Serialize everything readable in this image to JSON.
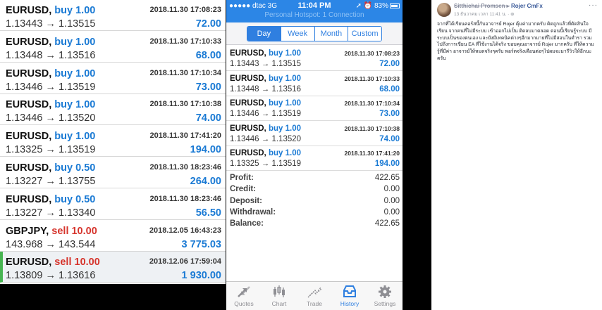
{
  "left_history": {
    "rows": [
      {
        "symbol": "EURUSD,",
        "side": "buy 1.00",
        "side_type": "buy",
        "date": "2018.11.30 17:08:23",
        "prices": "1.13443 → 1.13515",
        "profit": "72.00"
      },
      {
        "symbol": "EURUSD,",
        "side": "buy 1.00",
        "side_type": "buy",
        "date": "2018.11.30 17:10:33",
        "prices": "1.13448 → 1.13516",
        "profit": "68.00"
      },
      {
        "symbol": "EURUSD,",
        "side": "buy 1.00",
        "side_type": "buy",
        "date": "2018.11.30 17:10:34",
        "prices": "1.13446 → 1.13519",
        "profit": "73.00"
      },
      {
        "symbol": "EURUSD,",
        "side": "buy 1.00",
        "side_type": "buy",
        "date": "2018.11.30 17:10:38",
        "prices": "1.13446 → 1.13520",
        "profit": "74.00"
      },
      {
        "symbol": "EURUSD,",
        "side": "buy 1.00",
        "side_type": "buy",
        "date": "2018.11.30 17:41:20",
        "prices": "1.13325 → 1.13519",
        "profit": "194.00"
      },
      {
        "symbol": "EURUSD,",
        "side": "buy 0.50",
        "side_type": "buy",
        "date": "2018.11.30 18:23:46",
        "prices": "1.13227 → 1.13755",
        "profit": "264.00"
      },
      {
        "symbol": "EURUSD,",
        "side": "buy 0.50",
        "side_type": "buy",
        "date": "2018.11.30 18:23:46",
        "prices": "1.13227 → 1.13340",
        "profit": "56.50"
      },
      {
        "symbol": "GBPJPY,",
        "side": "sell 10.00",
        "side_type": "sell",
        "date": "2018.12.05 16:43:23",
        "prices": "143.968 → 143.544",
        "profit": "3 775.03"
      },
      {
        "symbol": "EURUSD,",
        "side": "sell 10.00",
        "side_type": "sell",
        "date": "2018.12.06 17:59:04",
        "prices": "1.13809 → 1.13616",
        "profit": "1 930.00"
      }
    ]
  },
  "phone": {
    "status": {
      "carrier": "●●●●● dtac  3G",
      "time": "11:04 PM",
      "right": "➚ ⏰ 83%",
      "hotspot": "Personal Hotspot: 1 Connection"
    },
    "segments": [
      "Day",
      "Week",
      "Month",
      "Custom"
    ],
    "active_segment": "Day",
    "rows": [
      {
        "symbol": "EURUSD,",
        "side": "buy 1.00",
        "date": "2018.11.30 17:08:23",
        "prices": "1.13443 → 1.13515",
        "profit": "72.00"
      },
      {
        "symbol": "EURUSD,",
        "side": "buy 1.00",
        "date": "2018.11.30 17:10:33",
        "prices": "1.13448 → 1.13516",
        "profit": "68.00"
      },
      {
        "symbol": "EURUSD,",
        "side": "buy 1.00",
        "date": "2018.11.30 17:10:34",
        "prices": "1.13446 → 1.13519",
        "profit": "73.00"
      },
      {
        "symbol": "EURUSD,",
        "side": "buy 1.00",
        "date": "2018.11.30 17:10:38",
        "prices": "1.13446 → 1.13520",
        "profit": "74.00"
      },
      {
        "symbol": "EURUSD,",
        "side": "buy 1.00",
        "date": "2018.11.30 17:41:20",
        "prices": "1.13325 → 1.13519",
        "profit": "194.00"
      }
    ],
    "summary": [
      {
        "label": "Profit:",
        "value": "422.65"
      },
      {
        "label": "Credit:",
        "value": "0.00"
      },
      {
        "label": "Deposit:",
        "value": "0.00"
      },
      {
        "label": "Withdrawal:",
        "value": "0.00"
      },
      {
        "label": "Balance:",
        "value": "422.65"
      }
    ],
    "tabs": [
      {
        "label": "Quotes",
        "icon": "quotes-icon"
      },
      {
        "label": "Chart",
        "icon": "chart-icon"
      },
      {
        "label": "Trade",
        "icon": "trade-icon"
      },
      {
        "label": "History",
        "icon": "history-icon"
      },
      {
        "label": "Settings",
        "icon": "settings-icon"
      }
    ],
    "active_tab": "History"
  },
  "post": {
    "author": "Rojer CmFx",
    "author_prefix": "Sitthichai Promsen ▸",
    "date": "13 ธันวาคม เวลา 11:41 น. · ⊕",
    "more": "···",
    "text": "จากที่ได้เรียนคอร์สนี้กับอาจารย์ Rojer คุ้มค่ามากครับ คิดถูกแล้วที่ตัดสินใจเรียน จากคนที่ไม่มีระบบ เข้าออกไม่เป็น ติดลบมาตลอด ตอนนี้เรียนรู้ระบบ มีระบบเป็นของตนเอง และยังมีเทคนิคต่างๆอีกมากมายที่ไม่มีสอนในตำรา รวมไปถึงการเขียน EA ที่ใช้งานได้จริง ขอบคุณอาจารย์ Rojer มากครับ ที่ให้ความรู้ที่มีค่า อาจารย์ให้หมดจริงๆครับ พอร์ตจริงเดือนต่อๆไปผมจะมารีวิวให้อีกนะครับ"
  }
}
